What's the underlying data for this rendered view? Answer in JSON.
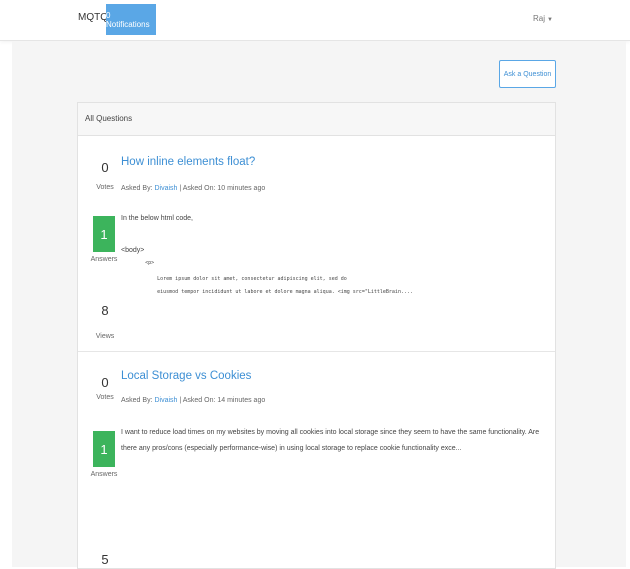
{
  "navbar": {
    "brand": "MQTQ",
    "notifications": "0 Notifications",
    "user": "Raj",
    "user_caret": "▼"
  },
  "toolbar": {
    "ask_label": "Ask a Question"
  },
  "list": {
    "header": "All Questions",
    "questions": [
      {
        "votes": "0",
        "votes_label": "Votes",
        "answers": "1",
        "answers_label": "Answers",
        "views": "8",
        "views_label": "Views",
        "title": "How inline elements float?",
        "asked_by_label": "Asked By:",
        "author": "Divaish",
        "asked_on": " | Asked On: 10 minutes ago",
        "excerpt_lines": [
          "In the below html code,",
          "",
          "<body>",
          "        <p>",
          "            Lorem ipsum dolor sit amet, consectetur adipiscing elit, sed do",
          "            eiusmod tempor incididunt ut labore et dolore magna aliqua. <img src=\"LittleBrain...."
        ]
      },
      {
        "votes": "0",
        "votes_label": "Votes",
        "answers": "1",
        "answers_label": "Answers",
        "views": "5",
        "title": "Local Storage vs Cookies",
        "asked_by_label": "Asked By:",
        "author": "Divaish",
        "asked_on": " | Asked On: 14 minutes ago",
        "excerpt": "I want to reduce load times on my websites by moving all cookies into local storage since they seem to have the same functionality. Are there any pros/cons (especially performance-wise) in using local storage to replace cookie functionality exce..."
      }
    ]
  },
  "colors": {
    "primary": "#5aa7e6",
    "link": "#3d8fd4",
    "answer_badge": "#3cb45c",
    "page_bg": "#f5f5f5"
  }
}
